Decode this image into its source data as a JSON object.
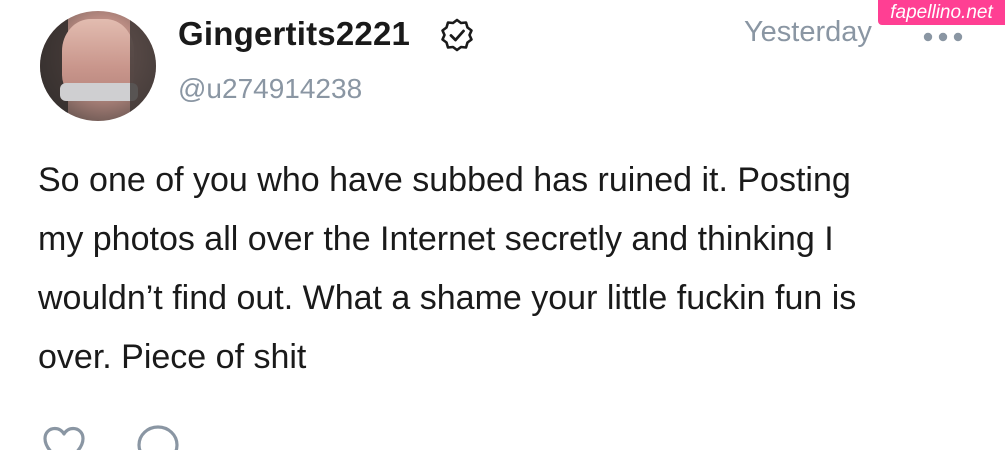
{
  "post": {
    "author": {
      "display_name": "Gingertits2221",
      "handle": "@u274914238",
      "verified_icon": "verified-badge-icon"
    },
    "timestamp": "Yesterday",
    "more_icon": "more-dots-icon",
    "text_lines": [
      "So one of you who have subbed has ruined it. Posting",
      "my photos all over the Internet secretly and thinking I",
      "wouldn’t find out. What a shame your little fuckin fun is",
      "over. Piece of shit"
    ],
    "actions": {
      "like_icon": "heart-icon",
      "comment_icon": "comment-bubble-icon"
    }
  },
  "watermark": {
    "text": "fapellino.net"
  },
  "colors": {
    "text": "#1a1a1a",
    "muted": "#8a96a3",
    "watermark_bg": "#ff3f93"
  }
}
